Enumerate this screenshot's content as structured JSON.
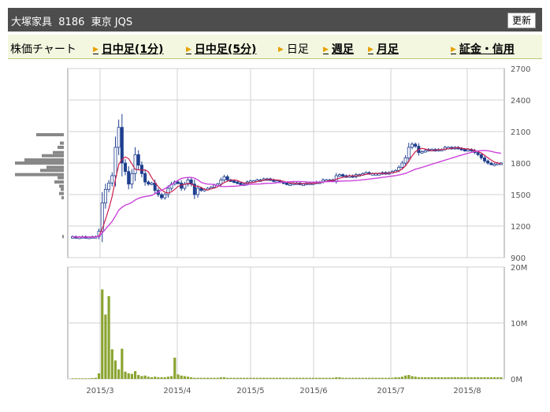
{
  "header": {
    "company": "大塚家具",
    "code": "8186",
    "market": "東京 JQS",
    "refresh_label": "更新"
  },
  "tabs": [
    {
      "label": "株価チャート",
      "link": false,
      "arrow": false
    },
    {
      "label": "日中足(1分)",
      "link": true,
      "arrow": true
    },
    {
      "label": "日中足(5分)",
      "link": true,
      "arrow": true
    },
    {
      "label": "日足",
      "link": false,
      "arrow": true
    },
    {
      "label": "週足",
      "link": true,
      "arrow": true
    },
    {
      "label": "月足",
      "link": true,
      "arrow": true
    },
    {
      "label": "証金・信用",
      "link": true,
      "arrow": true
    }
  ],
  "colors": {
    "candle": "#1f3f8f",
    "ma_short": "#cc1f4f",
    "ma_long": "#cc44dd",
    "volume": "#8aa532",
    "grid": "#d0d0d0",
    "volume_profile": "#888888"
  },
  "chart_data": [
    {
      "type": "candlestick",
      "y_axis_ticks": [
        "2700",
        "2400",
        "2100",
        "1800",
        "1500",
        "1200",
        "900"
      ],
      "ylim": [
        900,
        2700
      ],
      "x_tick_labels": [
        "2015/3",
        "2015/4",
        "2015/5",
        "2015/6",
        "2015/7",
        "2015/8"
      ],
      "series": [
        {
          "type": "candle",
          "close": [
            1100,
            1090,
            1095,
            1100,
            1090,
            1095,
            1100,
            1100,
            1150,
            1420,
            1550,
            1610,
            1680,
            1950,
            2140,
            1800,
            1720,
            1600,
            1700,
            1880,
            1780,
            1700,
            1620,
            1600,
            1610,
            1540,
            1500,
            1470,
            1500,
            1560,
            1600,
            1620,
            1610,
            1560,
            1600,
            1640,
            1600,
            1500,
            1560,
            1540,
            1550,
            1560,
            1570,
            1590,
            1600,
            1640,
            1670,
            1640,
            1630,
            1620,
            1610,
            1600,
            1600,
            1620,
            1630,
            1630,
            1640,
            1640,
            1650,
            1650,
            1640,
            1630,
            1630,
            1620,
            1610,
            1600,
            1600,
            1610,
            1610,
            1600,
            1600,
            1610,
            1610,
            1610,
            1620,
            1620,
            1640,
            1640,
            1640,
            1630,
            1680,
            1690,
            1680,
            1670,
            1680,
            1670,
            1690,
            1690,
            1700,
            1710,
            1700,
            1700,
            1700,
            1700,
            1710,
            1700,
            1710,
            1720,
            1730,
            1760,
            1800,
            1850,
            1950,
            1980,
            1960,
            1900,
            1910,
            1920,
            1930,
            1930,
            1920,
            1930,
            1930,
            1950,
            1950,
            1940,
            1950,
            1940,
            1930,
            1920,
            1930,
            1920,
            1900,
            1880,
            1850,
            1820,
            1800,
            1790,
            1790,
            1800,
            1800
          ]
        },
        {
          "type": "line",
          "name": "",
          "role": "short moving average"
        },
        {
          "type": "line",
          "name": "",
          "role": "long moving average"
        }
      ]
    },
    {
      "type": "bar",
      "y_axis_ticks": [
        "20M",
        "10M",
        "0M"
      ],
      "ylim": [
        0,
        20
      ],
      "unit": "M",
      "values": [
        0.1,
        0.1,
        0.1,
        0.1,
        0.1,
        0.1,
        0.15,
        0.2,
        1.0,
        16.0,
        11.5,
        14.8,
        5.3,
        3.3,
        1.7,
        5.4,
        1.3,
        1.0,
        0.9,
        1.4,
        0.7,
        0.5,
        0.6,
        0.4,
        0.3,
        0.4,
        0.3,
        0.3,
        0.3,
        0.4,
        0.5,
        3.8,
        0.8,
        0.6,
        0.5,
        0.4,
        0.3,
        0.2,
        0.2,
        0.2,
        0.2,
        0.2,
        0.2,
        0.2,
        0.2,
        0.3,
        0.3,
        0.2,
        0.2,
        0.2,
        0.2,
        0.2,
        0.2,
        0.2,
        0.2,
        0.2,
        0.2,
        0.2,
        0.2,
        0.2,
        0.2,
        0.2,
        0.2,
        0.2,
        0.2,
        0.2,
        0.2,
        0.2,
        0.2,
        0.2,
        0.2,
        0.2,
        0.2,
        0.2,
        0.2,
        0.2,
        0.2,
        0.2,
        0.2,
        0.2,
        0.3,
        0.3,
        0.2,
        0.2,
        0.2,
        0.2,
        0.2,
        0.2,
        0.2,
        0.2,
        0.2,
        0.2,
        0.2,
        0.2,
        0.2,
        0.2,
        0.2,
        0.2,
        0.3,
        0.3,
        0.4,
        0.6,
        0.7,
        0.5,
        0.4,
        0.3,
        0.3,
        0.3,
        0.3,
        0.3,
        0.3,
        0.3,
        0.3,
        0.3,
        0.3,
        0.3,
        0.3,
        0.3,
        0.3,
        0.3,
        0.3,
        0.3,
        0.3,
        0.3,
        0.3,
        0.3,
        0.3,
        0.3,
        0.3,
        0.3,
        0.3
      ]
    }
  ]
}
